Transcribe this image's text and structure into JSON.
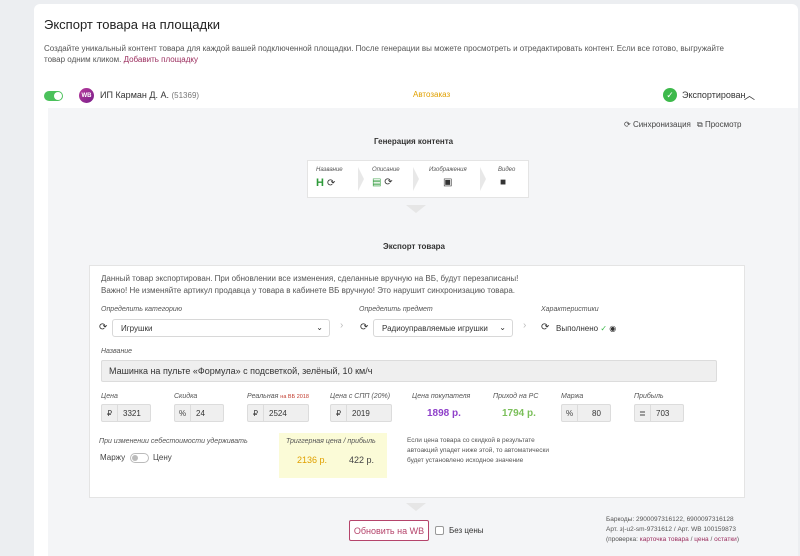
{
  "header": {
    "title": "Экспорт товара на площадки",
    "description": "Создайте уникальный контент товара для каждой вашей подключенной площадки. После генерации вы можете просмотреть и отредактировать контент. Если все готово, выгружайте товар одним кликом.",
    "add_link": "Добавить площадку"
  },
  "platform": {
    "badge": "WB",
    "name": "ИП Карман Д. А.",
    "id": "(51369)",
    "mode": "Автозаказ",
    "status": "Экспортирован",
    "sync_label": "Синхронизация",
    "preview_label": "Просмотр"
  },
  "generation": {
    "title": "Генерация контента",
    "steps": [
      {
        "label": "Название",
        "icon": "heading-icon"
      },
      {
        "label": "Описание",
        "icon": "document-icon"
      },
      {
        "label": "Изображения",
        "icon": "image-icon"
      },
      {
        "label": "Видео",
        "icon": "video-icon"
      }
    ]
  },
  "export": {
    "title": "Экспорт товара",
    "note_line1": "Данный товар экспортирован. При обновлении все изменения, сделанные вручную на ВБ, будут перезаписаны!",
    "note_line2": "Важно! Не изменяйте артикул продавца у товара в кабинете ВБ вручную! Это нарушит синхронизацию товара.",
    "category_label": "Определить категорию",
    "category_value": "Игрушки",
    "subject_label": "Определить предмет",
    "subject_value": "Радиоуправляемые игрушки",
    "chars_label": "Характеристики",
    "chars_value": "Выполнено",
    "name_label": "Название",
    "name_value": "Машинка на пульте «Формула» с подсветкой, зелёный, 10 км/ч",
    "price_label": "Цена",
    "price_prefix": "₽",
    "price_value": "3321",
    "discount_label": "Скидка",
    "discount_prefix": "%",
    "discount_value": "24",
    "real_label": "Реальная",
    "real_note": "на ВБ 2018",
    "real_prefix": "₽",
    "real_value": "2524",
    "spp_label": "Цена с СПП (20%)",
    "spp_prefix": "₽",
    "spp_value": "2019",
    "buyer_label": "Цена покупателя",
    "buyer_value": "1898 р.",
    "income_label": "Приход на РС",
    "income_value": "1794 р.",
    "margin_label": "Маржа",
    "margin_prefix": "%",
    "margin_value": "80",
    "profit_label": "Прибыль",
    "profit_value": "703",
    "keep_label": "При изменении себестоимости удерживать",
    "keep_left": "Маржу",
    "keep_right": "Цену",
    "trigger_label": "Триггерная цена / прибыль",
    "trigger_price": "2136 р.",
    "trigger_profit": "422 р.",
    "trigger_note": "Если цена товара со скидкой в результате автоакций упадет ниже этой, то автоматически будет установлено исходное значение"
  },
  "footer": {
    "update_button": "Обновить на WB",
    "no_prices": "Без цены",
    "barcodes": "Баркоды: 2900097316122, 6900097316128",
    "articles": "Арт. з|-u2-sm-9731612 / Арт. WB 100159873",
    "check_prefix": "(проверка:",
    "check_card": "карточка товара",
    "check_sep1": "/",
    "check_price": "цена",
    "check_sep2": "/",
    "check_stock": "остатки",
    "check_suffix": ")"
  },
  "colors": {
    "accent": "#9a2b5c",
    "green": "#3db94b",
    "orange": "#e0a000",
    "purple": "#8e3fc9"
  }
}
